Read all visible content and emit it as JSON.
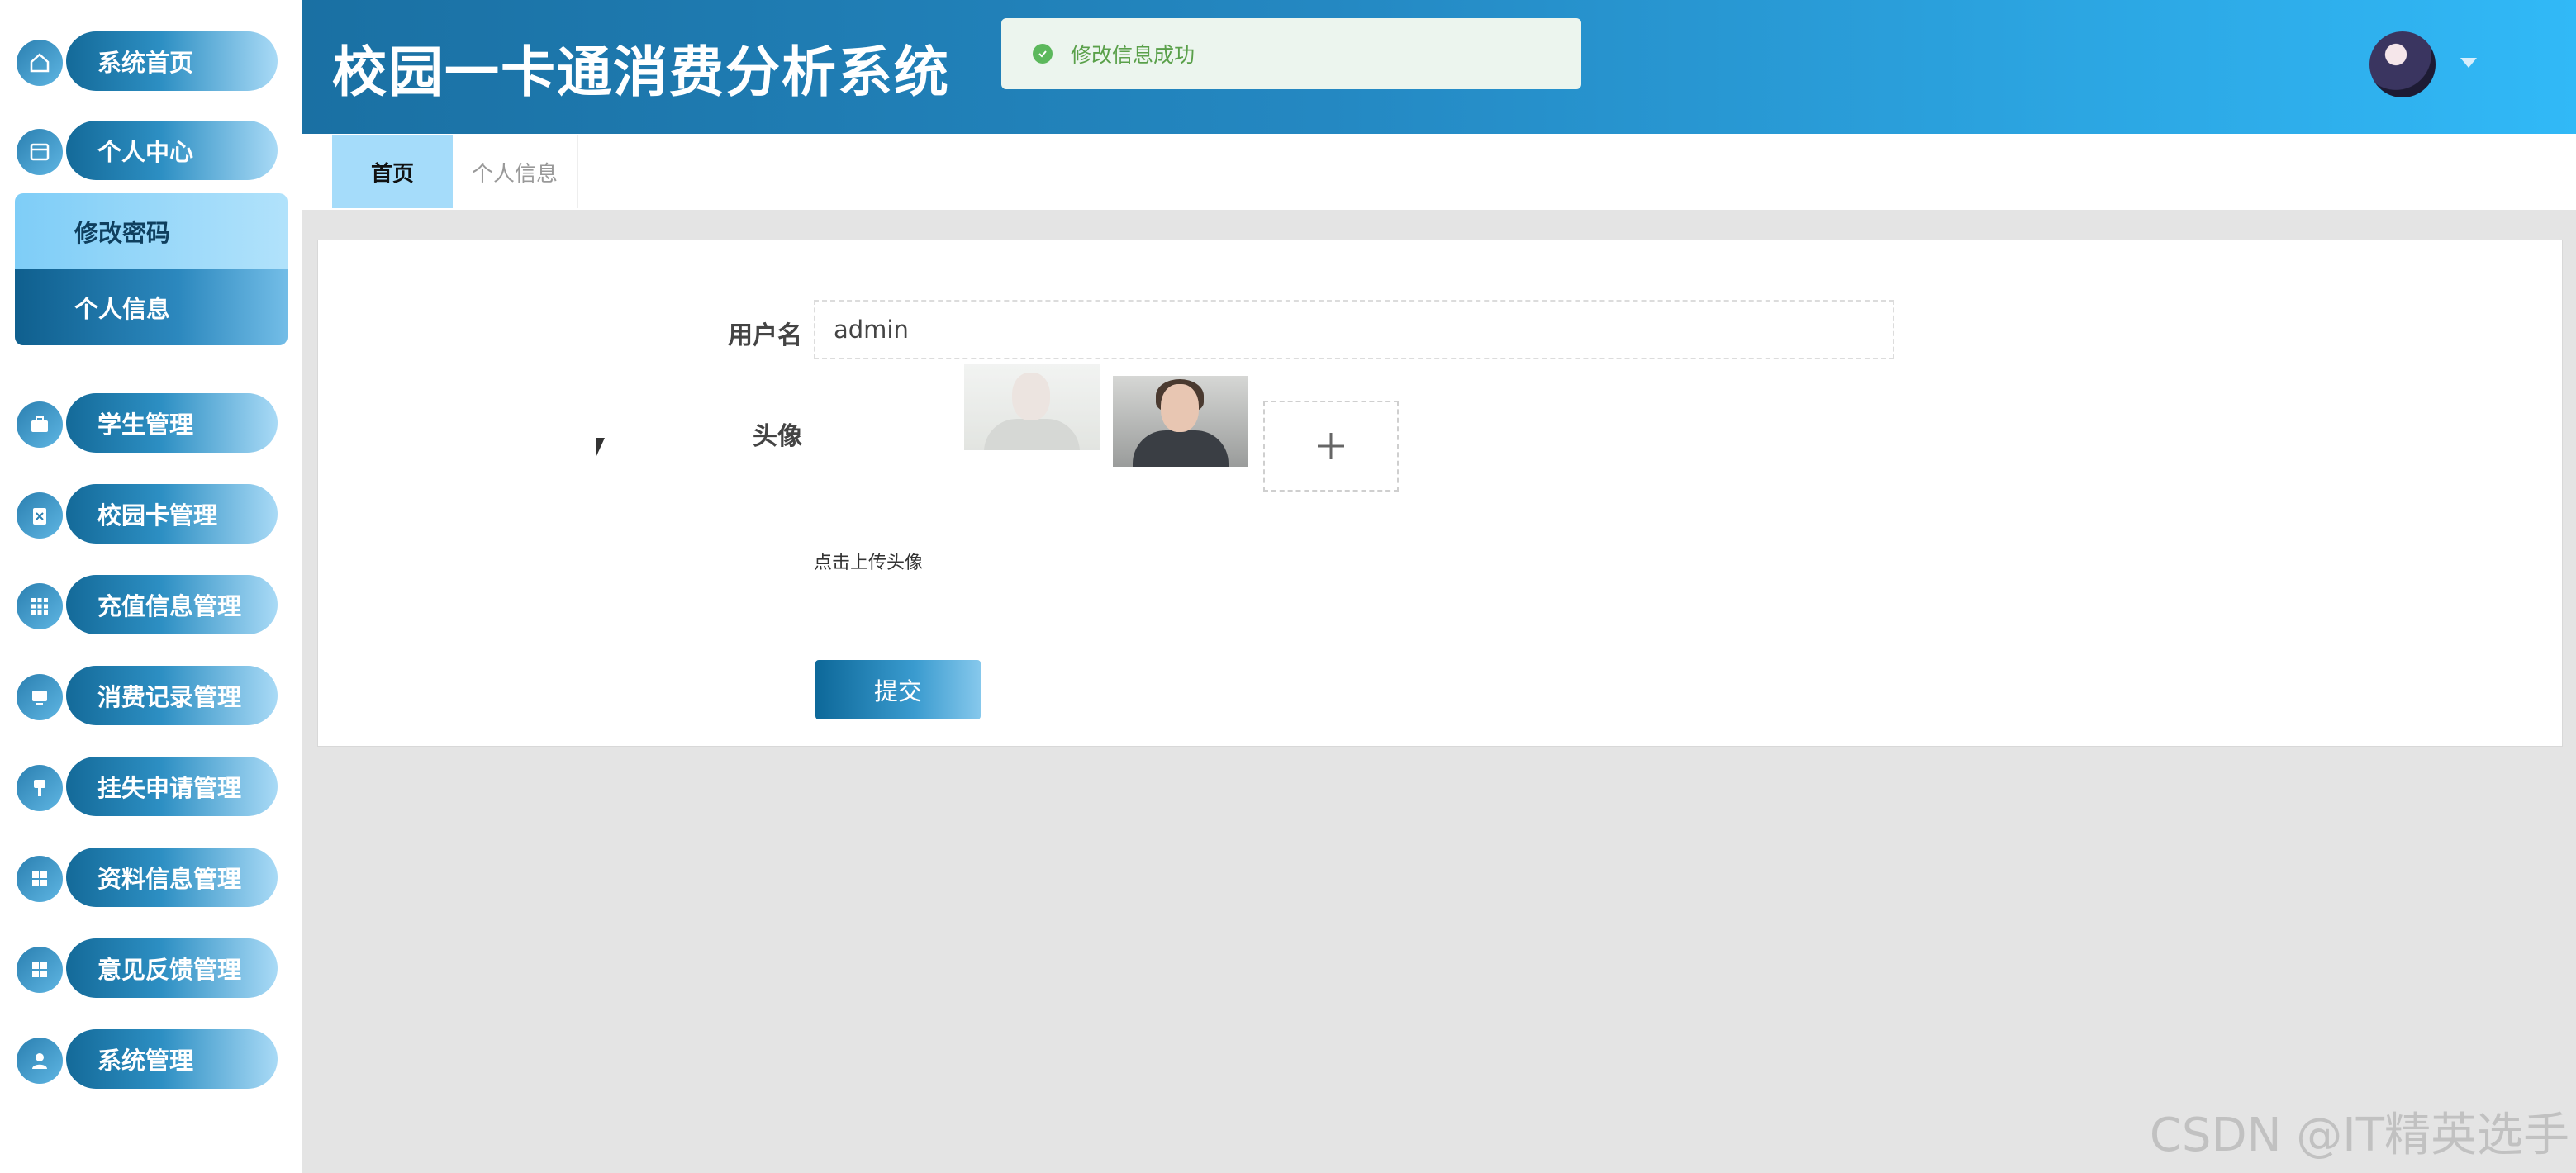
{
  "header": {
    "title": "校园一卡通消费分析系统"
  },
  "toast": {
    "message": "修改信息成功"
  },
  "sidebar": {
    "items": [
      {
        "label": "系统首页",
        "icon": "home-icon"
      },
      {
        "label": "个人中心",
        "icon": "window-icon"
      },
      {
        "label": "学生管理",
        "icon": "briefcase-icon"
      },
      {
        "label": "校园卡管理",
        "icon": "clipboard-x-icon"
      },
      {
        "label": "充值信息管理",
        "icon": "grid-icon"
      },
      {
        "label": "消费记录管理",
        "icon": "monitor-icon"
      },
      {
        "label": "挂失申请管理",
        "icon": "brush-icon"
      },
      {
        "label": "资料信息管理",
        "icon": "tiles-icon"
      },
      {
        "label": "意见反馈管理",
        "icon": "tiles-icon"
      },
      {
        "label": "系统管理",
        "icon": "user-icon"
      }
    ],
    "sub_items": [
      {
        "label": "修改密码"
      },
      {
        "label": "个人信息"
      }
    ]
  },
  "tabs": [
    {
      "label": "首页",
      "active": true
    },
    {
      "label": "个人信息",
      "active": false
    }
  ],
  "form": {
    "username_label": "用户名",
    "username_value": "admin",
    "avatar_label": "头像",
    "upload_hint": "点击上传头像",
    "submit_label": "提交"
  },
  "watermark": "CSDN @IT精英选手",
  "colors": {
    "accent": "#2488c2",
    "header_end": "#31b9f7",
    "tab_active": "#a5dcfa"
  }
}
